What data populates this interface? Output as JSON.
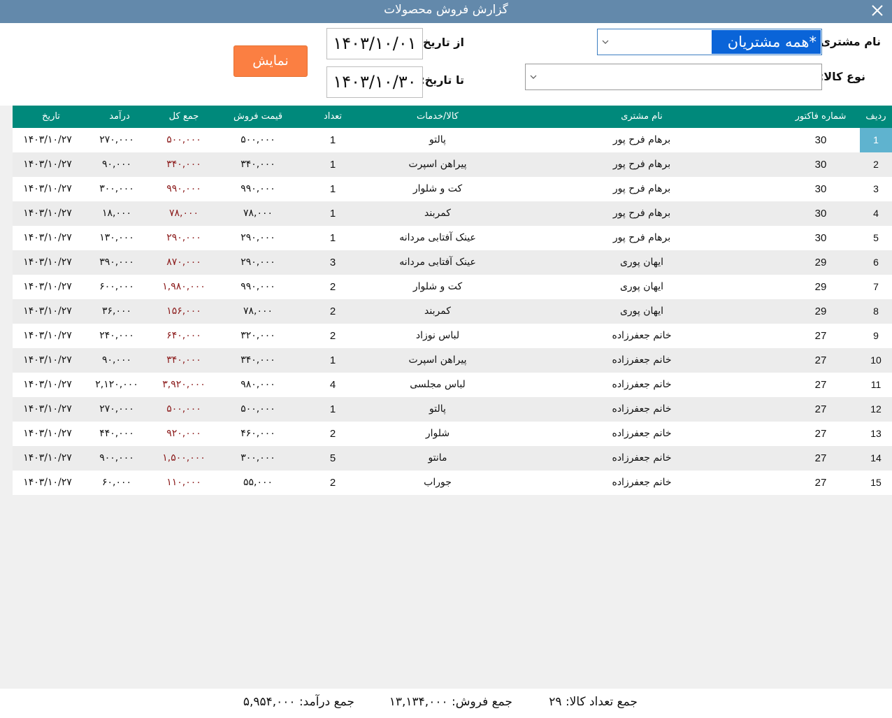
{
  "window": {
    "title": "گزارش فروش محصولات"
  },
  "filters": {
    "customer_label": "نام مشتری:",
    "customer_value": "*همه مشتریان",
    "product_type_label": "نوع کالا:",
    "product_type_value": "",
    "from_date_label": "از تاریخ:",
    "from_date_value": "۱۴۰۳/۱۰/۰۱",
    "to_date_label": "تا تاریخ:",
    "to_date_value": "۱۴۰۳/۱۰/۳۰",
    "show_button": "نمایش"
  },
  "grid": {
    "headers": {
      "row_no": "ردیف",
      "invoice_no": "شماره فاکتور",
      "customer": "نام مشتری",
      "product": "کالا/خدمات",
      "qty": "تعداد",
      "price": "قیمت فروش",
      "total": "جمع کل",
      "income": "درآمد",
      "date": "تاریخ"
    },
    "rows": [
      {
        "n": "1",
        "inv": "30",
        "cust": "برهام فرح پور",
        "prod": "پالتو",
        "qty": "1",
        "price": "۵۰۰,۰۰۰",
        "total": "۵۰۰,۰۰۰",
        "income": "۲۷۰,۰۰۰",
        "date": "۱۴۰۳/۱۰/۲۷"
      },
      {
        "n": "2",
        "inv": "30",
        "cust": "برهام فرح پور",
        "prod": "پیراهن اسپرت",
        "qty": "1",
        "price": "۳۴۰,۰۰۰",
        "total": "۳۴۰,۰۰۰",
        "income": "۹۰,۰۰۰",
        "date": "۱۴۰۳/۱۰/۲۷"
      },
      {
        "n": "3",
        "inv": "30",
        "cust": "برهام فرح پور",
        "prod": "کت و شلوار",
        "qty": "1",
        "price": "۹۹۰,۰۰۰",
        "total": "۹۹۰,۰۰۰",
        "income": "۳۰۰,۰۰۰",
        "date": "۱۴۰۳/۱۰/۲۷"
      },
      {
        "n": "4",
        "inv": "30",
        "cust": "برهام فرح پور",
        "prod": "کمربند",
        "qty": "1",
        "price": "۷۸,۰۰۰",
        "total": "۷۸,۰۰۰",
        "income": "۱۸,۰۰۰",
        "date": "۱۴۰۳/۱۰/۲۷"
      },
      {
        "n": "5",
        "inv": "30",
        "cust": "برهام فرح پور",
        "prod": "عینک آفتابی مردانه",
        "qty": "1",
        "price": "۲۹۰,۰۰۰",
        "total": "۲۹۰,۰۰۰",
        "income": "۱۳۰,۰۰۰",
        "date": "۱۴۰۳/۱۰/۲۷"
      },
      {
        "n": "6",
        "inv": "29",
        "cust": "ایهان پوری",
        "prod": "عینک آفتابی مردانه",
        "qty": "3",
        "price": "۲۹۰,۰۰۰",
        "total": "۸۷۰,۰۰۰",
        "income": "۳۹۰,۰۰۰",
        "date": "۱۴۰۳/۱۰/۲۷"
      },
      {
        "n": "7",
        "inv": "29",
        "cust": "ایهان پوری",
        "prod": "کت و شلوار",
        "qty": "2",
        "price": "۹۹۰,۰۰۰",
        "total": "۱,۹۸۰,۰۰۰",
        "income": "۶۰۰,۰۰۰",
        "date": "۱۴۰۳/۱۰/۲۷"
      },
      {
        "n": "8",
        "inv": "29",
        "cust": "ایهان پوری",
        "prod": "کمربند",
        "qty": "2",
        "price": "۷۸,۰۰۰",
        "total": "۱۵۶,۰۰۰",
        "income": "۳۶,۰۰۰",
        "date": "۱۴۰۳/۱۰/۲۷"
      },
      {
        "n": "9",
        "inv": "27",
        "cust": "خانم جعفرزاده",
        "prod": "لباس نوزاد",
        "qty": "2",
        "price": "۳۲۰,۰۰۰",
        "total": "۶۴۰,۰۰۰",
        "income": "۲۴۰,۰۰۰",
        "date": "۱۴۰۳/۱۰/۲۷"
      },
      {
        "n": "10",
        "inv": "27",
        "cust": "خانم جعفرزاده",
        "prod": "پیراهن اسپرت",
        "qty": "1",
        "price": "۳۴۰,۰۰۰",
        "total": "۳۴۰,۰۰۰",
        "income": "۹۰,۰۰۰",
        "date": "۱۴۰۳/۱۰/۲۷"
      },
      {
        "n": "11",
        "inv": "27",
        "cust": "خانم جعفرزاده",
        "prod": "لباس مجلسی",
        "qty": "4",
        "price": "۹۸۰,۰۰۰",
        "total": "۳,۹۲۰,۰۰۰",
        "income": "۲,۱۲۰,۰۰۰",
        "date": "۱۴۰۳/۱۰/۲۷"
      },
      {
        "n": "12",
        "inv": "27",
        "cust": "خانم جعفرزاده",
        "prod": "پالتو",
        "qty": "1",
        "price": "۵۰۰,۰۰۰",
        "total": "۵۰۰,۰۰۰",
        "income": "۲۷۰,۰۰۰",
        "date": "۱۴۰۳/۱۰/۲۷"
      },
      {
        "n": "13",
        "inv": "27",
        "cust": "خانم جعفرزاده",
        "prod": "شلوار",
        "qty": "2",
        "price": "۴۶۰,۰۰۰",
        "total": "۹۲۰,۰۰۰",
        "income": "۴۴۰,۰۰۰",
        "date": "۱۴۰۳/۱۰/۲۷"
      },
      {
        "n": "14",
        "inv": "27",
        "cust": "خانم جعفرزاده",
        "prod": "مانتو",
        "qty": "5",
        "price": "۳۰۰,۰۰۰",
        "total": "۱,۵۰۰,۰۰۰",
        "income": "۹۰۰,۰۰۰",
        "date": "۱۴۰۳/۱۰/۲۷"
      },
      {
        "n": "15",
        "inv": "27",
        "cust": "خانم جعفرزاده",
        "prod": "جوراب",
        "qty": "2",
        "price": "۵۵,۰۰۰",
        "total": "۱۱۰,۰۰۰",
        "income": "۶۰,۰۰۰",
        "date": "۱۴۰۳/۱۰/۲۷"
      }
    ]
  },
  "footer": {
    "total_qty": "جمع تعداد کالا: ۲۹",
    "total_sales": "جمع فروش: ۱۳,۱۳۴,۰۰۰",
    "total_income": "جمع درآمد: ۵,۹۵۴,۰۰۰"
  },
  "colors": {
    "titlebar": "#6389ab",
    "grid_header": "#00897b",
    "show_button": "#fb7f42",
    "selected_row": "#5fb3cf",
    "total_text": "#8b1a1a"
  }
}
